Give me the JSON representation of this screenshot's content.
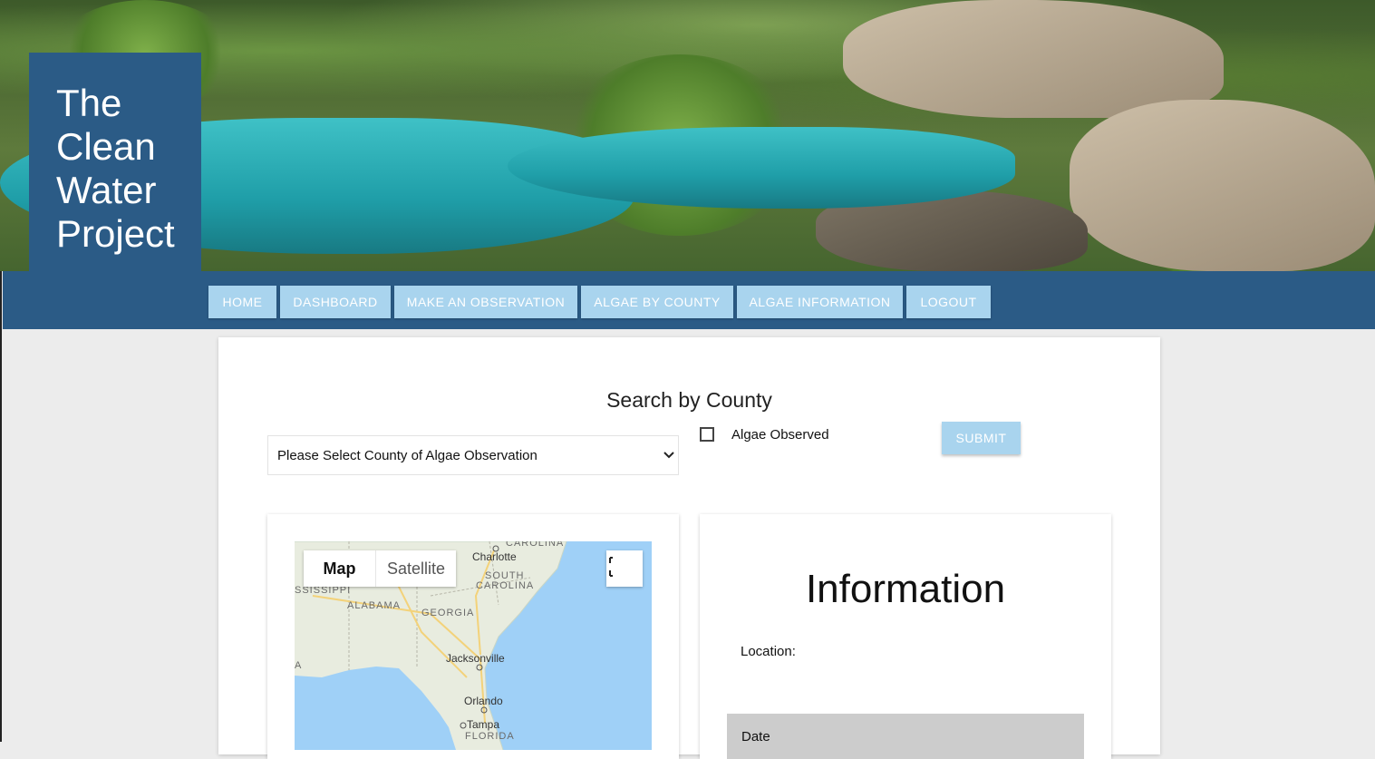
{
  "logo": {
    "title_lines": [
      "The",
      "Clean",
      "Water",
      "Project"
    ]
  },
  "nav": {
    "items": [
      {
        "label": "HOME"
      },
      {
        "label": "DASHBOARD"
      },
      {
        "label": "MAKE AN OBSERVATION"
      },
      {
        "label": "ALGAE BY COUNTY"
      },
      {
        "label": "ALGAE INFORMATION"
      },
      {
        "label": "LOGOUT"
      }
    ]
  },
  "search": {
    "title": "Search by County",
    "select_value": "Please Select County of Algae Observation",
    "checkbox_label": "Algae Observed",
    "checkbox_checked": false,
    "submit_label": "SUBMIT"
  },
  "map": {
    "toggle_map": "Map",
    "toggle_satellite": "Satellite",
    "labels": {
      "carolina": "CAROLINA",
      "charlotte": "Charlotte",
      "south": "SOUTH",
      "south_carolina": "CAROLINA",
      "mississippi": "SSISSIPPI",
      "alabama": "ALABAMA",
      "georgia": "GEORGIA",
      "jacksonville": "Jacksonville",
      "a": "A",
      "orlando": "Orlando",
      "tampa": "Tampa",
      "florida": "FLORIDA"
    },
    "colors": {
      "water": "#9fd0f7",
      "land": "#e8ecdf",
      "highway": "#f3d27a"
    }
  },
  "info": {
    "title": "Information",
    "location_label": "Location:",
    "date_label": "Date"
  },
  "colors": {
    "brand_blue": "#2b5b86",
    "button_light_blue": "#a9d4ee",
    "page_bg": "#ececec"
  }
}
